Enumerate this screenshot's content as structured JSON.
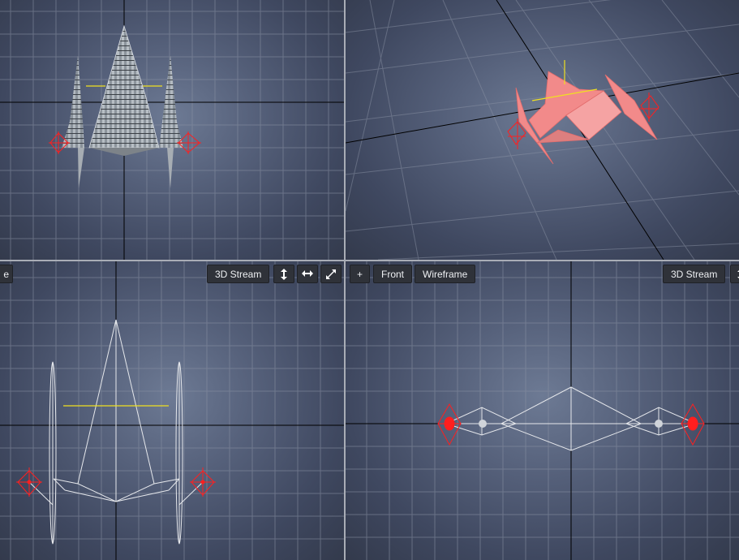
{
  "viewports": {
    "top_left": {},
    "top_right": {},
    "bottom_left": {
      "view_label_partial": "e",
      "stream_label": "3D Stream"
    },
    "bottom_right": {
      "add_label": "+",
      "view_label": "Front",
      "shading_label": "Wireframe",
      "stream_label": "3D Stream"
    }
  },
  "icons": {
    "pan_vertical": "arrow-up-down-icon",
    "pan_horizontal": "arrow-left-right-icon",
    "maximize": "expand-diagonal-icon"
  },
  "colors": {
    "viewport_bg": "#55607a",
    "grid_line": "#8a92a4",
    "axis_line": "#000000",
    "wireframe": "#e6e8ec",
    "handle_red": "#ff1f1f",
    "bone_yellow": "#f0e020",
    "model_pink": "#f28a8a",
    "divider": "#a9adb6",
    "button_bg": "#2f3239"
  }
}
